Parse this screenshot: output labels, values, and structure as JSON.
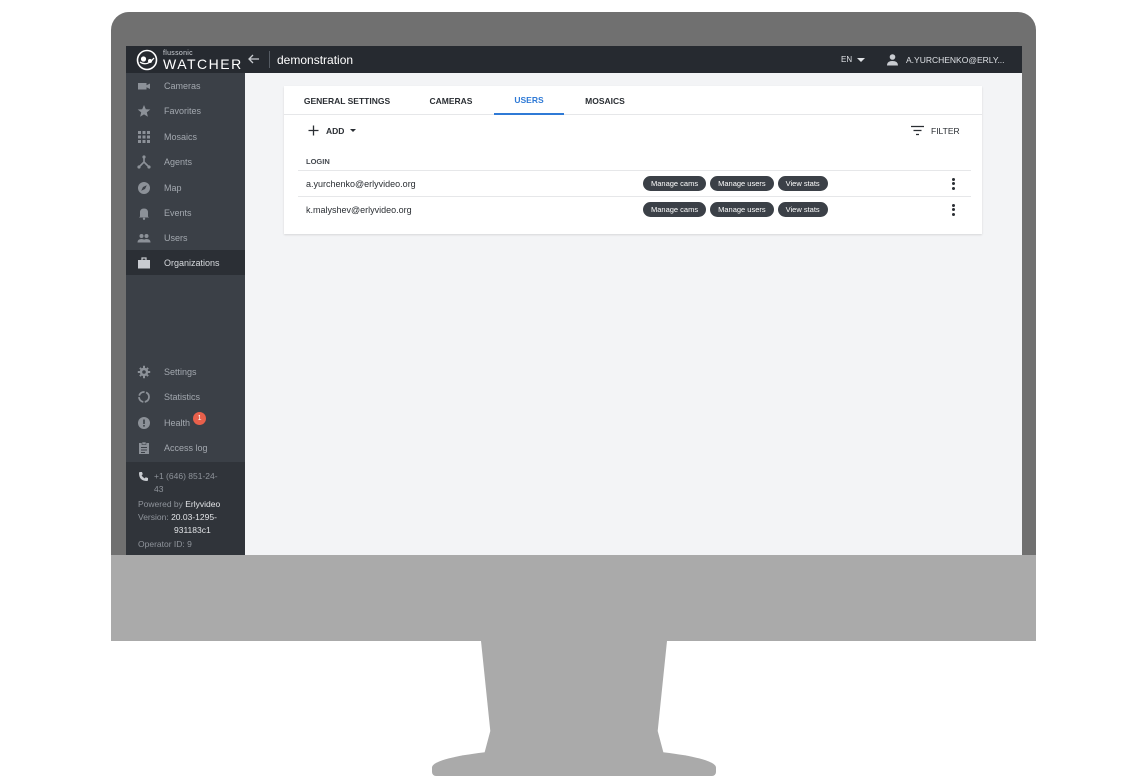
{
  "app": {
    "brand_small": "flussonic",
    "brand_big": "WATCHER",
    "page_title": "demonstration",
    "language": "EN",
    "user": "A.YURCHENKO@ERLY..."
  },
  "sidebar": {
    "items": [
      {
        "label": "Cameras",
        "icon": "camera-icon"
      },
      {
        "label": "Favorites",
        "icon": "star-icon"
      },
      {
        "label": "Mosaics",
        "icon": "grid-icon"
      },
      {
        "label": "Agents",
        "icon": "hub-icon"
      },
      {
        "label": "Map",
        "icon": "compass-icon"
      },
      {
        "label": "Events",
        "icon": "bell-icon"
      },
      {
        "label": "Users",
        "icon": "people-icon"
      },
      {
        "label": "Organizations",
        "icon": "briefcase-icon"
      }
    ],
    "bottom_items": [
      {
        "label": "Settings",
        "icon": "gear-icon"
      },
      {
        "label": "Statistics",
        "icon": "donut-chart-icon"
      },
      {
        "label": "Health",
        "icon": "alert-icon",
        "badge": "1"
      },
      {
        "label": "Access log",
        "icon": "clipboard-icon"
      }
    ],
    "footer": {
      "phone_line1": "+1 (646) 851-24-",
      "phone_line2": "43",
      "powered_prefix": "Powered by ",
      "powered_name": "Erlyvideo",
      "version_prefix": "Version: ",
      "version_line1": "20.03-1295-",
      "version_line2": "931183c1",
      "operator": "Operator ID: 9"
    }
  },
  "tabs": [
    {
      "label": "GENERAL SETTINGS"
    },
    {
      "label": "CAMERAS"
    },
    {
      "label": "USERS"
    },
    {
      "label": "MOSAICS"
    }
  ],
  "toolbar": {
    "add_label": "ADD",
    "filter_label": "FILTER"
  },
  "table": {
    "column_login": "LOGIN",
    "rows": [
      {
        "login": "a.yurchenko@erlyvideo.org",
        "btn_cams": "Manage cams",
        "btn_users": "Manage users",
        "btn_stats": "View stats"
      },
      {
        "login": "k.malyshev@erlyvideo.org",
        "btn_cams": "Manage cams",
        "btn_users": "Manage users",
        "btn_stats": "View stats"
      }
    ]
  },
  "colors": {
    "accent": "#2f7ad6",
    "sidebar": "#3b4047",
    "topbar": "#262a30",
    "badge": "#e8604b"
  }
}
